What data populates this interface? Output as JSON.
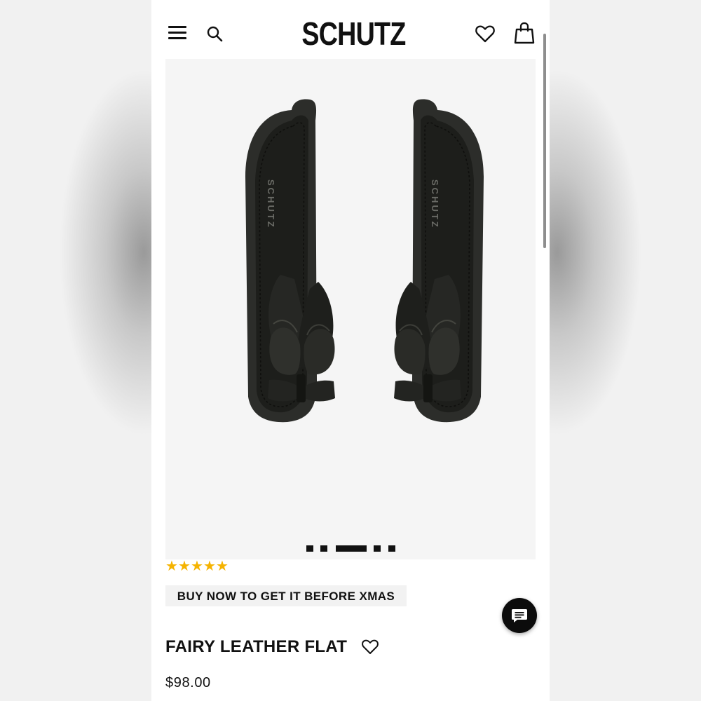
{
  "header": {
    "logo": "SCHUTZ",
    "menu_icon": "hamburger-menu-icon",
    "search_icon": "search-icon",
    "wishlist_icon": "heart-icon",
    "bag_icon": "shopping-bag-icon"
  },
  "product": {
    "image": "black-leather-knotted-flat-sandals-pair",
    "insole_brand": "SCHUTZ",
    "gallery": {
      "total": 5,
      "active": 3
    },
    "rating": {
      "stars": 5,
      "max": 5
    },
    "promo": "BUY NOW TO GET IT BEFORE XMAS",
    "title": "FAIRY LEATHER FLAT",
    "favorite_icon": "heart-outline-icon",
    "price": "$98.00"
  },
  "chat": {
    "icon": "chat-bubble-icon"
  },
  "colors": {
    "accent": "#111111",
    "star": "#f5b301",
    "image_bg": "#f5f5f5",
    "promo_bg": "#f2f2f2"
  }
}
